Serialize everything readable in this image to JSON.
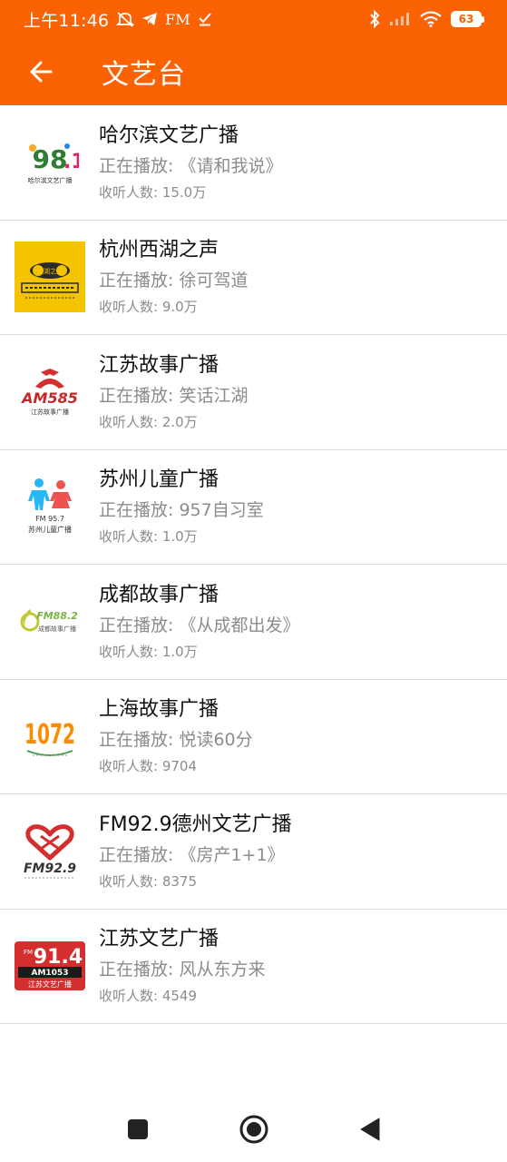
{
  "status_bar": {
    "time": "上午11:46",
    "fm_label": "FM",
    "battery": "63",
    "icons": [
      "mute-icon",
      "telegram-icon",
      "fm-icon",
      "check-icon",
      "bluetooth-icon",
      "signal-icon",
      "wifi-icon",
      "battery-icon"
    ]
  },
  "header": {
    "title": "文艺台",
    "back_icon": "arrow-left-icon",
    "background": "#fb6203"
  },
  "stations": [
    {
      "name": "哈尔滨文艺广播",
      "playing": "正在播放: 《请和我说》",
      "listeners": "收听人数: 15.0万",
      "logo": "harbin-logo",
      "logo_text": "哈尔滨文艺广播"
    },
    {
      "name": "杭州西湖之声",
      "playing": "正在播放: 徐可驾道",
      "listeners": "收听人数: 9.0万",
      "logo": "hangzhou-logo",
      "logo_text": "西湖之声"
    },
    {
      "name": "江苏故事广播",
      "playing": "正在播放: 笑话江湖",
      "listeners": "收听人数: 2.0万",
      "logo": "jiangsu-story-logo",
      "logo_text": "AM585",
      "logo_sub": "江苏故事广播"
    },
    {
      "name": "苏州儿童广播",
      "playing": "正在播放: 957自习室",
      "listeners": "收听人数: 1.0万",
      "logo": "suzhou-children-logo",
      "logo_text": "FM 95.7",
      "logo_sub": "苏州儿童广播"
    },
    {
      "name": "成都故事广播",
      "playing": "正在播放: 《从成都出发》",
      "listeners": "收听人数: 1.0万",
      "logo": "chengdu-story-logo",
      "logo_text": "FM88.2",
      "logo_sub": "成都故事广播"
    },
    {
      "name": "上海故事广播",
      "playing": "正在播放: 悦读60分",
      "listeners": "收听人数: 9704",
      "logo": "shanghai-story-logo",
      "logo_text": "1072"
    },
    {
      "name": "FM92.9德州文艺广播",
      "playing": "正在播放: 《房产1+1》",
      "listeners": "收听人数: 8375",
      "logo": "dezhou-logo",
      "logo_text": "FM92.9"
    },
    {
      "name": "江苏文艺广播",
      "playing": "正在播放: 风从东方来",
      "listeners": "收听人数: 4549",
      "logo": "jiangsu-arts-logo",
      "logo_text": "91.4",
      "logo_am": "AM1053",
      "logo_sub": "江苏文艺广播"
    }
  ],
  "nav_bar": {
    "icons": [
      "recent-apps-icon",
      "home-icon",
      "back-icon"
    ]
  }
}
